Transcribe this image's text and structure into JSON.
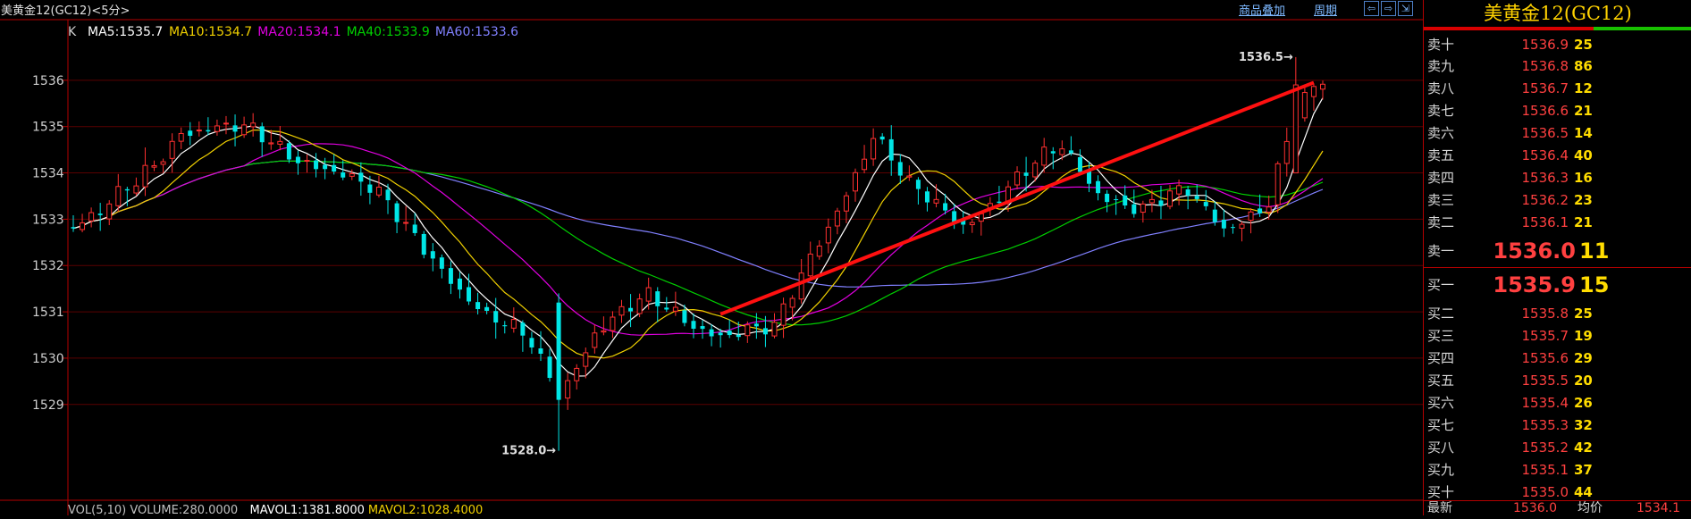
{
  "header": {
    "title": "美黄金12(GC12)<5分>",
    "overlay_link": "商品叠加",
    "period_link": "周期",
    "nav_buttons": [
      {
        "icon": "arrow-left-icon",
        "glyph": "⇦"
      },
      {
        "icon": "arrow-right-icon",
        "glyph": "⇨"
      },
      {
        "icon": "expand-icon",
        "glyph": "⇲"
      }
    ]
  },
  "ma_legend": {
    "k_label": "K",
    "items": [
      {
        "text": "MA5:1535.7",
        "color": "#ffffff"
      },
      {
        "text": "MA10:1534.7",
        "color": "#f0d000"
      },
      {
        "text": "MA20:1534.1",
        "color": "#e000e0"
      },
      {
        "text": "MA40:1533.9",
        "color": "#00d000"
      },
      {
        "text": "MA60:1533.6",
        "color": "#8080ff"
      }
    ]
  },
  "volume_legend": {
    "items": [
      {
        "text": "VOL(5,10) VOLUME:280.0000",
        "color": "#c0c0c0"
      },
      {
        "text": "MAVOL1:1381.8000",
        "color": "#ffffff"
      },
      {
        "text": "MAVOL2:1028.4000",
        "color": "#f0d000"
      }
    ]
  },
  "chart_data": {
    "type": "candlestick",
    "y_ticks": [
      "1536",
      "1535",
      "1534",
      "1533",
      "1532",
      "1531",
      "1530",
      "1529"
    ],
    "ylim": [
      1527.8,
      1537.0
    ],
    "high_marker": "1536.5",
    "low_marker": "1528.0",
    "colors": {
      "up": "#ff3030",
      "down": "#00e6e6",
      "trend": "#ff1010",
      "grid": "#5a0000"
    }
  },
  "quote": {
    "title": "美黄金12(GC12)",
    "asks": [
      {
        "label": "卖十",
        "price": "1536.9",
        "volume": "25"
      },
      {
        "label": "卖九",
        "price": "1536.8",
        "volume": "86"
      },
      {
        "label": "卖八",
        "price": "1536.7",
        "volume": "12"
      },
      {
        "label": "卖七",
        "price": "1536.6",
        "volume": "21"
      },
      {
        "label": "卖六",
        "price": "1536.5",
        "volume": "14"
      },
      {
        "label": "卖五",
        "price": "1536.4",
        "volume": "40"
      },
      {
        "label": "卖四",
        "price": "1536.3",
        "volume": "16"
      },
      {
        "label": "卖三",
        "price": "1536.2",
        "volume": "23"
      },
      {
        "label": "卖二",
        "price": "1536.1",
        "volume": "21"
      },
      {
        "label": "卖一",
        "price": "1536.0",
        "volume": "11"
      }
    ],
    "bids": [
      {
        "label": "买一",
        "price": "1535.9",
        "volume": "15"
      },
      {
        "label": "买二",
        "price": "1535.8",
        "volume": "25"
      },
      {
        "label": "买三",
        "price": "1535.7",
        "volume": "19"
      },
      {
        "label": "买四",
        "price": "1535.6",
        "volume": "29"
      },
      {
        "label": "买五",
        "price": "1535.5",
        "volume": "20"
      },
      {
        "label": "买六",
        "price": "1535.4",
        "volume": "26"
      },
      {
        "label": "买七",
        "price": "1535.3",
        "volume": "32"
      },
      {
        "label": "买八",
        "price": "1535.2",
        "volume": "42"
      },
      {
        "label": "买九",
        "price": "1535.1",
        "volume": "37"
      },
      {
        "label": "买十",
        "price": "1535.0",
        "volume": "44"
      }
    ],
    "footer": {
      "latest_label": "最新",
      "latest_value": "1536.0",
      "avg_label": "均价",
      "avg_value": "1534.1"
    }
  }
}
